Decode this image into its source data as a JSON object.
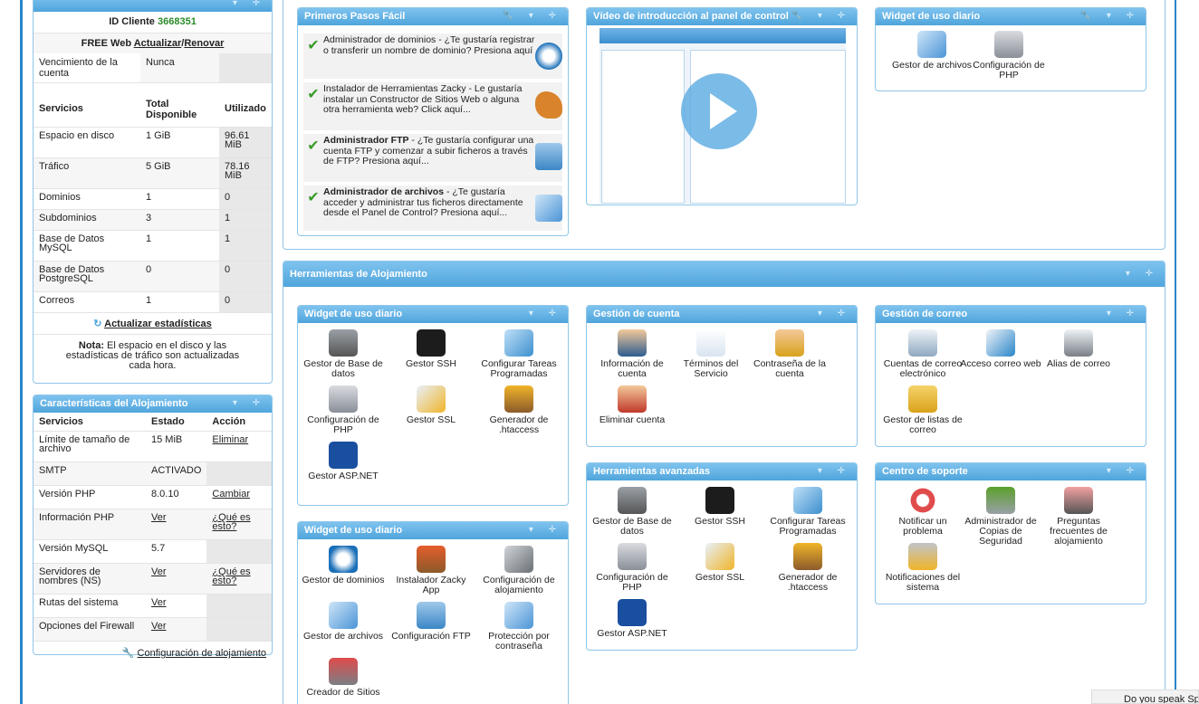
{
  "account": {
    "client_id_label": "ID Cliente",
    "client_id": "3668351",
    "plan": "FREE Web",
    "update_link": "Actualizar",
    "slash": "/",
    "renew_link": "Renovar",
    "expiry_label": "Vencimiento de la cuenta",
    "expiry_value": "Nunca",
    "headers": [
      "Servicios",
      "Total Disponible",
      "Utilizado"
    ],
    "rows": [
      {
        "service": "Espacio en disco",
        "total": "1 GiB",
        "used": "96.61 MiB"
      },
      {
        "service": "Tráfico",
        "total": "5 GiB",
        "used": "78.16 MiB"
      },
      {
        "service": "Dominios",
        "total": "1",
        "used": "0"
      },
      {
        "service": "Subdominios",
        "total": "3",
        "used": "1"
      },
      {
        "service": "Base de Datos MySQL",
        "total": "1",
        "used": "1"
      },
      {
        "service": "Base de Datos PostgreSQL",
        "total": "0",
        "used": "0"
      },
      {
        "service": "Correos",
        "total": "1",
        "used": "0"
      }
    ],
    "update_stats": "Actualizar estadísticas",
    "note_label": "Nota:",
    "note_text": "El espacio en el disco y las estadísticas de tráfico son actualizadas cada hora."
  },
  "features": {
    "title": "Características del Alojamiento",
    "headers": [
      "Servicios",
      "Estado",
      "Acción"
    ],
    "rows": [
      {
        "service": "Límite de tamaño de archivo",
        "state": "15 MiB",
        "action": "Eliminar"
      },
      {
        "service": "SMTP",
        "state": "ACTIVADO",
        "action": ""
      },
      {
        "service": "Versión PHP",
        "state": "8.0.10",
        "action": "Cambiar"
      },
      {
        "service": "Información PHP",
        "state": "Ver",
        "action": "¿Qué es esto?"
      },
      {
        "service": "Versión MySQL",
        "state": "5.7",
        "action": ""
      },
      {
        "service": "Servidores de nombres (NS)",
        "state": "Ver",
        "action": "¿Qué es esto?"
      },
      {
        "service": "Rutas del sistema",
        "state": "Ver",
        "action": ""
      },
      {
        "service": "Opciones del Firewall",
        "state": "Ver",
        "action": ""
      }
    ],
    "config_link": "Configuración de alojamiento"
  },
  "first_steps": {
    "title": "Primeros Pasos Fácil",
    "items": [
      {
        "text": "Administrador de dominios - ¿Te gustaría registrar o transferir un nombre de dominio? Presiona aquí",
        "icon": "www-icon"
      },
      {
        "text": "Instalador de Herramientas Zacky - Le gustaría instalar un Constructor de Sitios Web o alguna otra herramienta web? Click aquí...",
        "icon": "kangaroo-icon"
      },
      {
        "bold": "Administrador FTP",
        "text": " - ¿Te gustaría configurar una cuenta FTP y comenzar a subir ficheros a través de FTP? Presiona aquí...",
        "icon": "ftp-icon"
      },
      {
        "bold": "Administrador de archivos",
        "text": " - ¿Te gustaría acceder y administrar tus ficheros directamente desde el Panel de Control? Presiona aquí...",
        "icon": "files-icon"
      }
    ]
  },
  "video": {
    "title": "Vídeo de introducción al panel de control"
  },
  "daily_top": {
    "title": "Widget de uso diario",
    "items": [
      "Gestor de archivos",
      "Configuración de PHP"
    ]
  },
  "hosting_tools": {
    "title": "Herramientas de Alojamiento"
  },
  "daily1": {
    "title": "Widget de uso diario",
    "items": [
      "Gestor de Base de datos",
      "Gestor SSH",
      "Configurar Tareas Programadas",
      "Configuración de PHP",
      "Gestor SSL",
      "Generador de .htaccess",
      "Gestor ASP.NET"
    ]
  },
  "account_mgmt": {
    "title": "Gestión de cuenta",
    "items": [
      "Información de cuenta",
      "Términos del Servicio",
      "Contraseña de la cuenta",
      "Eliminar cuenta"
    ]
  },
  "mail_mgmt": {
    "title": "Gestión de correo",
    "items": [
      "Cuentas de correo electrónico",
      "Acceso correo web",
      "Alias de correo",
      "Gestor de listas de correo"
    ]
  },
  "advanced": {
    "title": "Herramientas avanzadas",
    "items": [
      "Gestor de Base de datos",
      "Gestor SSH",
      "Configurar Tareas Programadas",
      "Configuración de PHP",
      "Gestor SSL",
      "Generador de .htaccess",
      "Gestor ASP.NET"
    ]
  },
  "support": {
    "title": "Centro de soporte",
    "items": [
      "Notificar un problema",
      "Administrador de Copias de Seguridad",
      "Preguntas frecuentes de alojamiento",
      "Notificaciones del sistema"
    ]
  },
  "daily2": {
    "title": "Widget de uso diario",
    "items": [
      "Gestor de dominios",
      "Instalador Zacky App",
      "Configuración de alojamiento",
      "Gestor de archivos",
      "Configuración FTP",
      "Protección por contraseña",
      "Creador de Sitios"
    ]
  },
  "footer": {
    "lang": "Do you speak Sp"
  },
  "colors": {
    "header_blue": "#4fa5dc",
    "frame_blue": "#2a86c9",
    "check_green": "#3a9a2a"
  }
}
